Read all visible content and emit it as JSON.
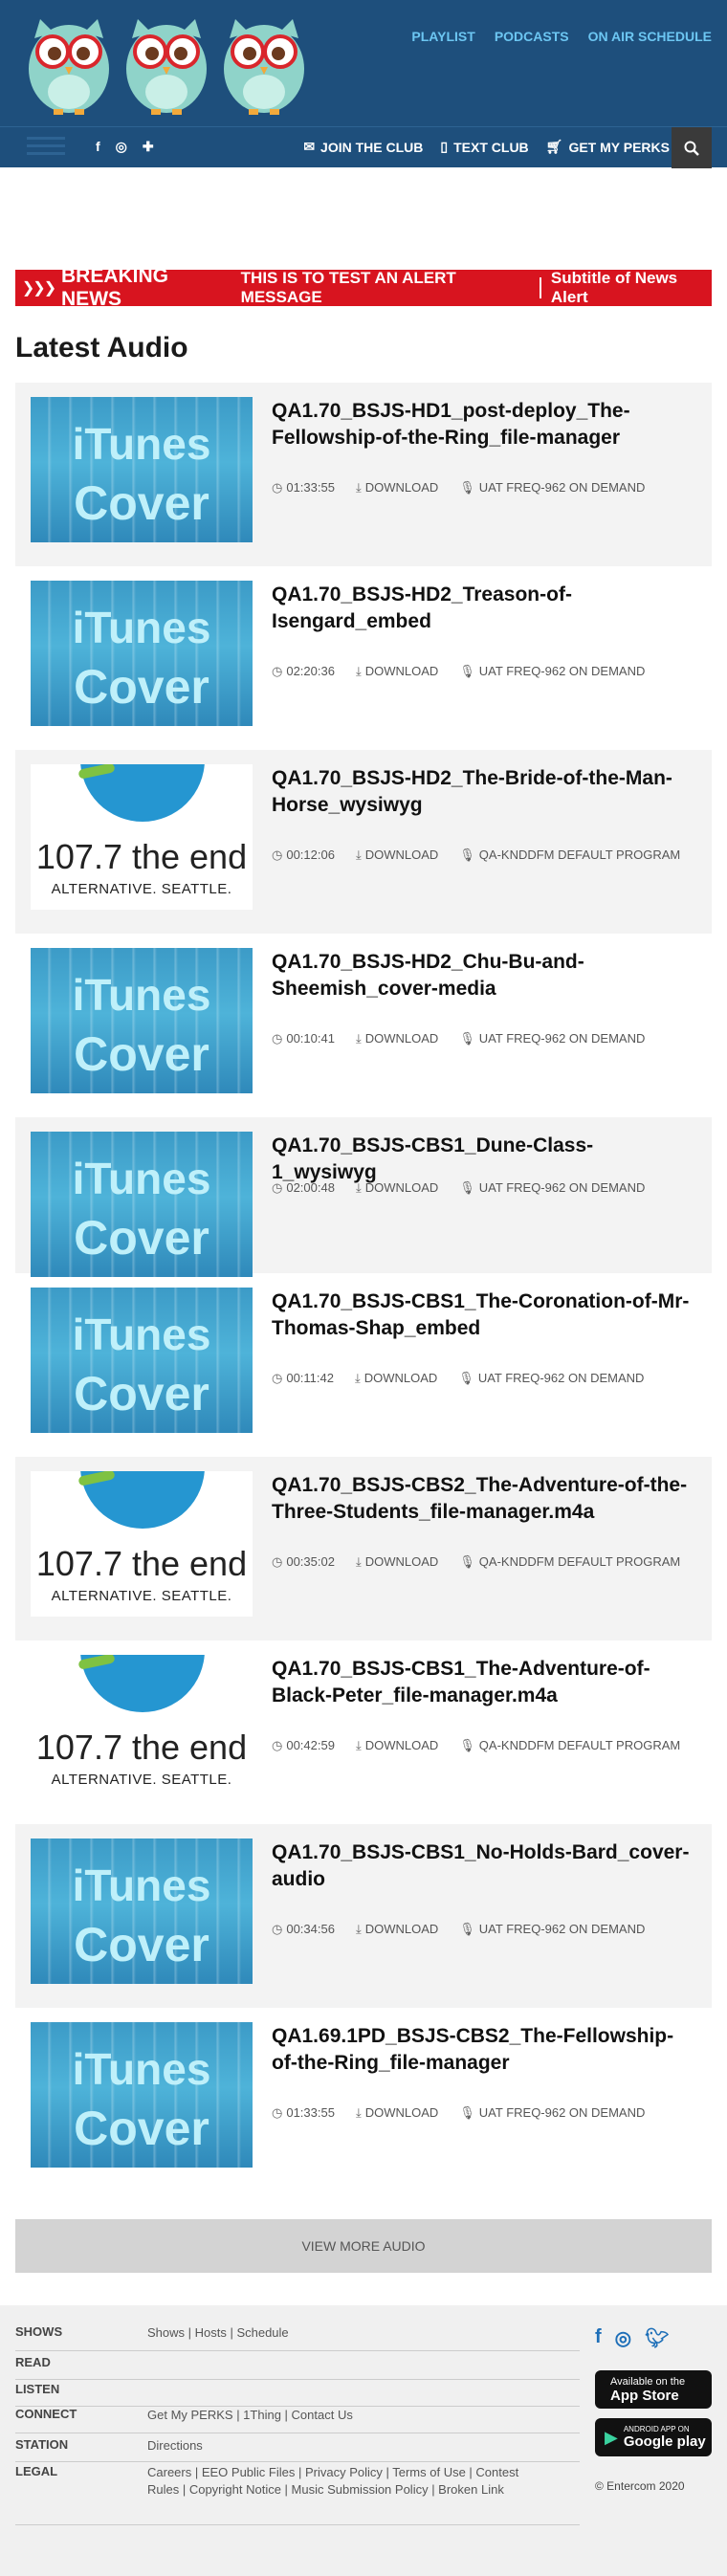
{
  "header": {
    "top_nav": [
      "PLAYLIST",
      "PODCASTS",
      "ON AIR SCHEDULE"
    ],
    "bar_links": [
      {
        "icon": "envelope-icon",
        "label": "JOIN THE CLUB"
      },
      {
        "icon": "phone-icon",
        "label": "TEXT CLUB"
      },
      {
        "icon": "cart-icon",
        "label": "GET MY PERKS"
      }
    ],
    "social_icons": [
      "facebook-icon",
      "instagram-icon",
      "plus-icon"
    ]
  },
  "breaking": {
    "label": "BREAKING NEWS",
    "message": "THIS IS TO TEST AN ALERT MESSAGE",
    "subtitle": "Subtitle of News Alert"
  },
  "section_title": "Latest Audio",
  "download_label": "DOWNLOAD",
  "items": [
    {
      "title": "QA1.70_BSJS-HD1_post-deploy_The-Fellowship-of-the-Ring_file-manager",
      "duration": "01:33:55",
      "program": "UAT FREQ-962 ON DEMAND",
      "thumb": "itunes"
    },
    {
      "title": "QA1.70_BSJS-HD2_Treason-of-Isengard_embed",
      "duration": "02:20:36",
      "program": "UAT FREQ-962 ON DEMAND",
      "thumb": "itunes"
    },
    {
      "title": "QA1.70_BSJS-HD2_The-Bride-of-the-Man-Horse_wysiwyg",
      "duration": "00:12:06",
      "program": "QA-KNDDFM DEFAULT PROGRAM",
      "thumb": "station"
    },
    {
      "title": "QA1.70_BSJS-HD2_Chu-Bu-and-Sheemish_cover-media",
      "duration": "00:10:41",
      "program": "UAT FREQ-962 ON DEMAND",
      "thumb": "itunes"
    },
    {
      "title": "QA1.70_BSJS-CBS1_Dune-Class-1_wysiwyg",
      "duration": "02:00:48",
      "program": "UAT FREQ-962 ON DEMAND",
      "thumb": "itunes"
    },
    {
      "title": "QA1.70_BSJS-CBS1_The-Coronation-of-Mr-Thomas-Shap_embed",
      "duration": "00:11:42",
      "program": "UAT FREQ-962 ON DEMAND",
      "thumb": "itunes"
    },
    {
      "title": "QA1.70_BSJS-CBS2_The-Adventure-of-the-Three-Students_file-manager.m4a",
      "duration": "00:35:02",
      "program": "QA-KNDDFM DEFAULT PROGRAM",
      "thumb": "station"
    },
    {
      "title": "QA1.70_BSJS-CBS1_The-Adventure-of-Black-Peter_file-manager.m4a",
      "duration": "00:42:59",
      "program": "QA-KNDDFM DEFAULT PROGRAM",
      "thumb": "station"
    },
    {
      "title": "QA1.70_BSJS-CBS1_No-Holds-Bard_cover-audio",
      "duration": "00:34:56",
      "program": "UAT FREQ-962 ON DEMAND",
      "thumb": "itunes"
    },
    {
      "title": "QA1.69.1PD_BSJS-CBS2_The-Fellowship-of-the-Ring_file-manager",
      "duration": "01:33:55",
      "program": "UAT FREQ-962 ON DEMAND",
      "thumb": "itunes"
    }
  ],
  "thumb_text": {
    "itunes_line1": "iTunes",
    "itunes_line2": "Cover",
    "station_freq": "107.7 the end",
    "station_tag": "ALTERNATIVE. SEATTLE."
  },
  "view_more": "VIEW MORE AUDIO",
  "footer": {
    "rows": [
      {
        "key": "SHOWS",
        "value": "Shows | Hosts | Schedule"
      },
      {
        "key": "READ",
        "value": ""
      },
      {
        "key": "LISTEN",
        "value": ""
      },
      {
        "key": "CONNECT",
        "value": "Get My PERKS | 1Thing | Contact Us"
      },
      {
        "key": "STATION",
        "value": "Directions"
      },
      {
        "key": "LEGAL",
        "value": "Careers | EEO Public Files | Privacy Policy | Terms of Use | Contest Rules | Copyright Notice | Music Submission Policy | Broken Link"
      }
    ],
    "app_store": {
      "small": "Available on the",
      "big": "App Store"
    },
    "google_play": {
      "small": "ANDROID APP ON",
      "big": "Google play"
    },
    "copyright": "© Entercom 2020"
  },
  "colors": {
    "header_bg": "#1e4f7c",
    "accent": "#6cc6f2",
    "breaking": "#d8141f"
  }
}
